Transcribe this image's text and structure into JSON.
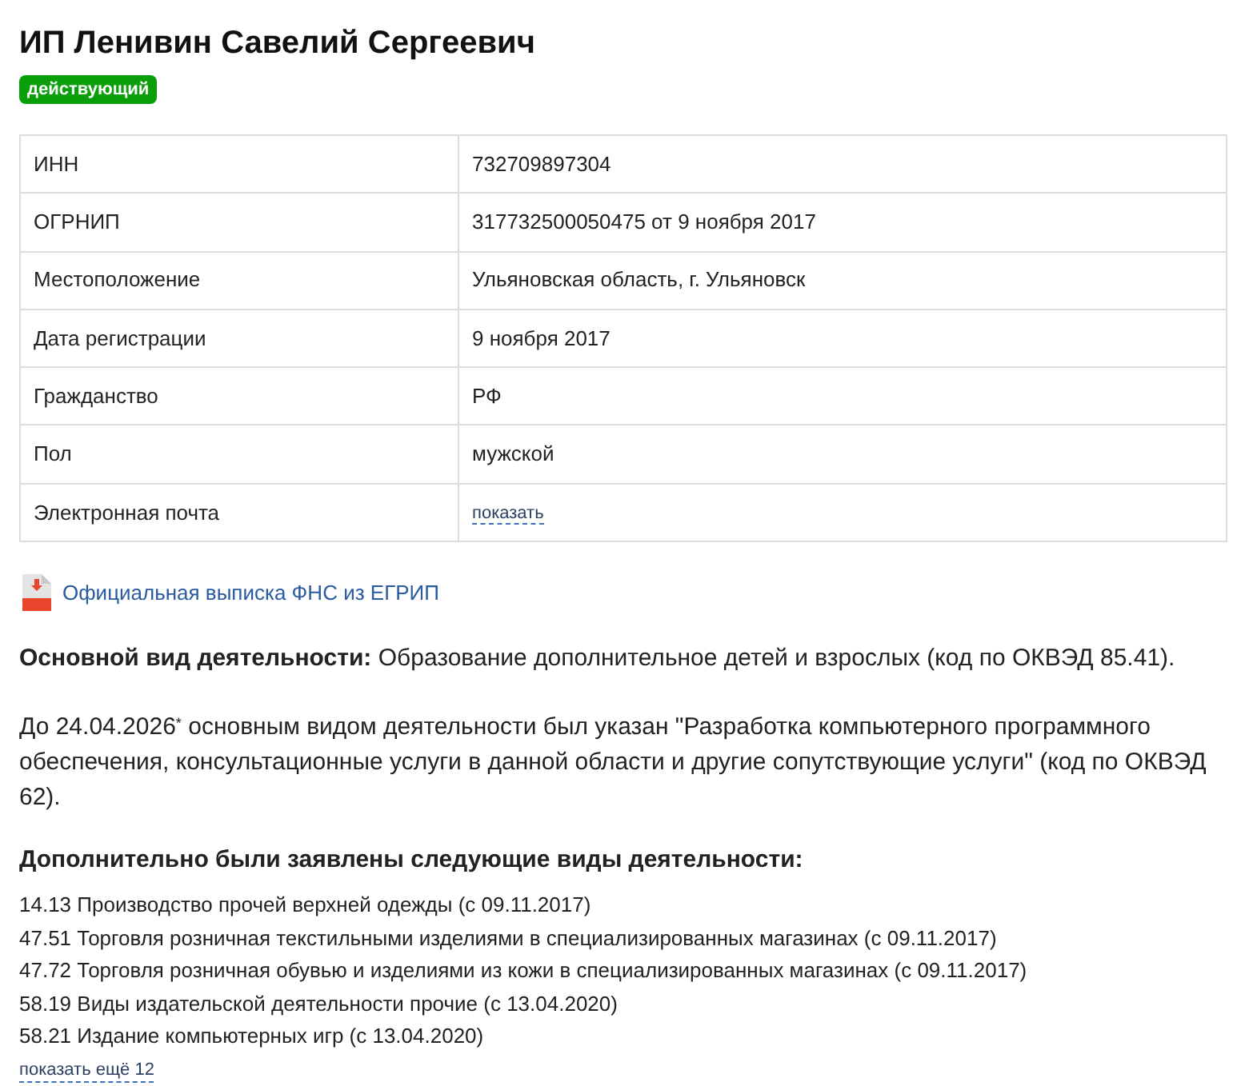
{
  "header": {
    "title": "ИП Ленивин Савелий Сергеевич",
    "status_badge": "действующий"
  },
  "details_table": {
    "rows": [
      {
        "label": "ИНН",
        "value": "732709897304",
        "kind": "text"
      },
      {
        "label": "ОГРНИП",
        "value": "317732500050475 от 9 ноября 2017",
        "kind": "text"
      },
      {
        "label": "Местоположение",
        "value": "Ульяновская область, г. Ульяновск",
        "kind": "text"
      },
      {
        "label": "Дата регистрации",
        "value": "9 ноября 2017",
        "kind": "text"
      },
      {
        "label": "Гражданство",
        "value": "РФ",
        "kind": "text"
      },
      {
        "label": "Пол",
        "value": "мужской",
        "kind": "text"
      },
      {
        "label": "Электронная почта",
        "value": "показать",
        "kind": "link"
      }
    ]
  },
  "pdf_link": {
    "label": "Официальная выписка ФНС из ЕГРИП"
  },
  "main_activity": "**Основной вид деятельности:** Образование дополнительное детей и взрослых (код по ОКВЭД 85.41).",
  "previous_activity": "До 24.04.2026$^{*}$ основным видом деятельности был указан \"Разработка компьютерного программного обеспечения, консультационные услуги в данной области и другие сопутствующие услуги\" (код по ОКВЭД 62).",
  "additional_activities": {
    "heading": "Дополнительно были заявлены следующие виды деятельности:",
    "items": [
      "14.13 Производство прочей верхней одежды (с 09.11.2017)",
      "47.51 Торговля розничная текстильными изделиями в специализированных магазинах (с 09.11.2017)",
      "47.72 Торговля розничная обувью и изделиями из кожи в специализированных магазинах (с 09.11.2017)",
      "58.19 Виды издательской деятельности прочие (с 13.04.2020)",
      "58.21 Издание компьютерных игр (с 13.04.2020)"
    ],
    "show_more": "показать ещё 12"
  }
}
